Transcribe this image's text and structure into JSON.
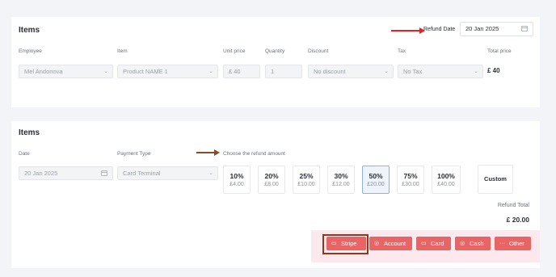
{
  "items_card": {
    "title": "Items",
    "refund_date_label": "Refund Date",
    "refund_date_value": "20 Jan 2025",
    "columns": [
      "Employee",
      "Item",
      "Unit price",
      "Quantity",
      "Discount",
      "Tax",
      "Total price"
    ],
    "row": {
      "employee": "Mel Andonova",
      "item": "Product NAME 1",
      "unit_price": "£ 40",
      "quantity": "1",
      "discount": "No discount",
      "tax": "No Tax",
      "total_price": "£ 40"
    }
  },
  "refund_card": {
    "title": "Items",
    "date_label": "Date",
    "date_value": "20 Jan 2025",
    "payment_type_label": "Payment Type",
    "payment_type_value": "Card Terminal",
    "choose_label": "Choose the refund amount",
    "options": [
      {
        "pct": "10%",
        "amount": "£4.00"
      },
      {
        "pct": "20%",
        "amount": "£8.00"
      },
      {
        "pct": "25%",
        "amount": "£10.00"
      },
      {
        "pct": "30%",
        "amount": "£12.00"
      },
      {
        "pct": "50%",
        "amount": "£20.00"
      },
      {
        "pct": "75%",
        "amount": "£30.00"
      },
      {
        "pct": "100%",
        "amount": "£40.00"
      }
    ],
    "selected_option": "50%",
    "custom_label": "Custom",
    "refund_total_label": "Refund Total",
    "refund_total_value": "£ 20.00",
    "payment_buttons": {
      "stripe": "Stripe",
      "account": "Account",
      "card": "Card",
      "cash": "Cash",
      "other": "Other"
    }
  },
  "colors": {
    "button_red": "#e96565",
    "highlight_border": "#8b3b1c",
    "annotation_arrow_red": "#e02424",
    "annotation_arrow_brown": "#8b4a1f",
    "selected_option_bg": "#eef4fb"
  },
  "icons": {
    "stripe": "credit-card-icon",
    "account": "circle-icon",
    "card": "credit-card-icon",
    "cash": "coin-icon",
    "other": "ellipsis-icon"
  }
}
